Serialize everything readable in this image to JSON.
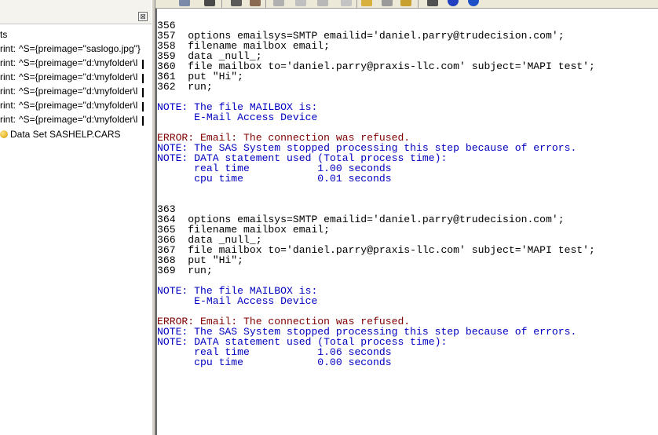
{
  "explorer": {
    "close_glyph": "⊠",
    "items": [
      {
        "prefix": "ts",
        "text": ""
      },
      {
        "prefix": "rint:",
        "text": "^S={preimage=\"saslogo.jpg\"}"
      },
      {
        "prefix": "rint:",
        "text": "^S={preimage=\"d:\\myfolder\\l"
      },
      {
        "prefix": "rint:",
        "text": "^S={preimage=\"d:\\myfolder\\l"
      },
      {
        "prefix": "rint:",
        "text": "^S={preimage=\"d:\\myfolder\\l"
      },
      {
        "prefix": "rint:",
        "text": "^S={preimage=\"d:\\myfolder\\l"
      },
      {
        "prefix": "rint:",
        "text": "^S={preimage=\"d:\\myfolder\\l"
      },
      {
        "prefix": "",
        "text": "Data Set SASHELP.CARS"
      }
    ]
  },
  "log": {
    "lines": [
      {
        "text": "356",
        "color": "black"
      },
      {
        "text": "357  options emailsys=SMTP emailid='daniel.parry@trudecision.com';",
        "color": "black"
      },
      {
        "text": "358  filename mailbox email;",
        "color": "black"
      },
      {
        "text": "359  data _null_;",
        "color": "black"
      },
      {
        "text": "360  file mailbox to='daniel.parry@praxis-llc.com' subject='MAPI test';",
        "color": "black"
      },
      {
        "text": "361  put \"Hi\";",
        "color": "black"
      },
      {
        "text": "362  run;",
        "color": "black"
      },
      {
        "text": "",
        "color": "black"
      },
      {
        "text": "NOTE: The file MAILBOX is:",
        "color": "blue"
      },
      {
        "text": "      E-Mail Access Device",
        "color": "blue"
      },
      {
        "text": "",
        "color": "black"
      },
      {
        "text": "ERROR: Email: The connection was refused.",
        "color": "maroon"
      },
      {
        "text": "NOTE: The SAS System stopped processing this step because of errors.",
        "color": "blue"
      },
      {
        "text": "NOTE: DATA statement used (Total process time):",
        "color": "blue"
      },
      {
        "text": "      real time           1.00 seconds",
        "color": "blue"
      },
      {
        "text": "      cpu time            0.01 seconds",
        "color": "blue"
      },
      {
        "text": "",
        "color": "black"
      },
      {
        "text": "",
        "color": "black"
      },
      {
        "text": "363",
        "color": "black"
      },
      {
        "text": "364  options emailsys=SMTP emailid='daniel.parry@trudecision.com';",
        "color": "black"
      },
      {
        "text": "365  filename mailbox email;",
        "color": "black"
      },
      {
        "text": "366  data _null_;",
        "color": "black"
      },
      {
        "text": "367  file mailbox to='daniel.parry@praxis-llc.com' subject='MAPI test';",
        "color": "black"
      },
      {
        "text": "368  put \"Hi\";",
        "color": "black"
      },
      {
        "text": "369  run;",
        "color": "black"
      },
      {
        "text": "",
        "color": "black"
      },
      {
        "text": "NOTE: The file MAILBOX is:",
        "color": "blue"
      },
      {
        "text": "      E-Mail Access Device",
        "color": "blue"
      },
      {
        "text": "",
        "color": "black"
      },
      {
        "text": "ERROR: Email: The connection was refused.",
        "color": "maroon"
      },
      {
        "text": "NOTE: The SAS System stopped processing this step because of errors.",
        "color": "blue"
      },
      {
        "text": "NOTE: DATA statement used (Total process time):",
        "color": "blue"
      },
      {
        "text": "      real time           1.06 seconds",
        "color": "blue"
      },
      {
        "text": "      cpu time            0.00 seconds",
        "color": "blue"
      }
    ]
  }
}
